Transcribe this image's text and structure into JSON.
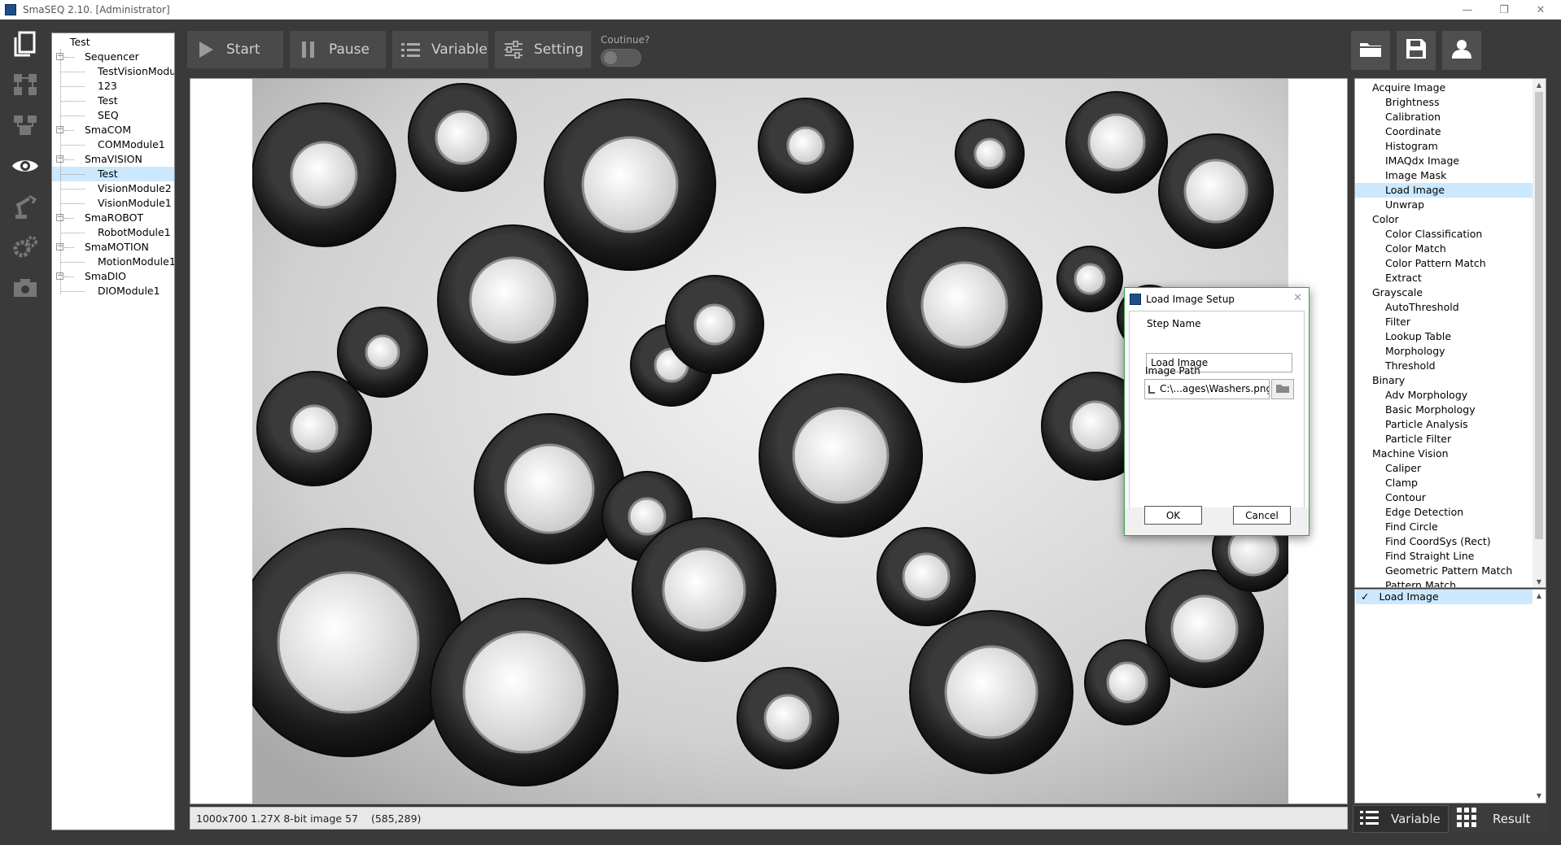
{
  "window": {
    "title": "SmaSEQ 2.10. [Administrator]",
    "minimize": "—",
    "maximize": "❐",
    "close": "✕"
  },
  "sidebar_icons": [
    "document-icon",
    "flow-icon",
    "module-icon",
    "eye-icon",
    "robot-arm-icon",
    "gears-icon",
    "camera-icon"
  ],
  "tree": [
    {
      "label": "Test",
      "level": 0
    },
    {
      "label": "Sequencer",
      "level": 1,
      "expander": "−"
    },
    {
      "label": "TestVisionModu",
      "level": 2
    },
    {
      "label": "123",
      "level": 2
    },
    {
      "label": "Test",
      "level": 2
    },
    {
      "label": "SEQ",
      "level": 2
    },
    {
      "label": "SmaCOM",
      "level": 1,
      "expander": "−"
    },
    {
      "label": "COMModule1",
      "level": 2
    },
    {
      "label": "SmaVISION",
      "level": 1,
      "expander": "−"
    },
    {
      "label": "Test",
      "level": 2,
      "selected": true
    },
    {
      "label": "VisionModule2",
      "level": 2
    },
    {
      "label": "VisionModule1",
      "level": 2
    },
    {
      "label": "SmaROBOT",
      "level": 1,
      "expander": "−"
    },
    {
      "label": "RobotModule1",
      "level": 2
    },
    {
      "label": "SmaMOTION",
      "level": 1,
      "expander": "−"
    },
    {
      "label": "MotionModule1",
      "level": 2
    },
    {
      "label": "SmaDIO",
      "level": 1,
      "expander": "−"
    },
    {
      "label": "DIOModule1",
      "level": 2
    }
  ],
  "toolbar": {
    "start": "Start",
    "pause": "Pause",
    "variable": "Variable",
    "setting": "Setting",
    "continue_label": "Coutinue?",
    "continue_on": false
  },
  "status": {
    "info": "1000x700 1.27X 8-bit image 57",
    "coord": "(585,289)"
  },
  "dialog": {
    "title": "Load Image Setup",
    "close": "✕",
    "step_name_label": "Step Name",
    "step_name_value": "Load Image",
    "image_path_label": "Image Path",
    "image_path_value": "C:\\...ages\\Washers.png",
    "ok": "OK",
    "cancel": "Cancel"
  },
  "steps": [
    {
      "label": "Acquire Image",
      "cat": true
    },
    {
      "label": "Brightness"
    },
    {
      "label": "Calibration"
    },
    {
      "label": "Coordinate"
    },
    {
      "label": "Histogram"
    },
    {
      "label": "IMAQdx Image"
    },
    {
      "label": "Image Mask"
    },
    {
      "label": "Load Image",
      "selected": true
    },
    {
      "label": "Unwrap"
    },
    {
      "label": "Color",
      "cat": true
    },
    {
      "label": "Color Classification"
    },
    {
      "label": "Color Match"
    },
    {
      "label": "Color Pattern Match"
    },
    {
      "label": "Extract"
    },
    {
      "label": "Grayscale",
      "cat": true
    },
    {
      "label": "AutoThreshold"
    },
    {
      "label": "Filter"
    },
    {
      "label": "Lookup Table"
    },
    {
      "label": "Morphology"
    },
    {
      "label": "Threshold"
    },
    {
      "label": "Binary",
      "cat": true
    },
    {
      "label": "Adv Morphology"
    },
    {
      "label": "Basic Morphology"
    },
    {
      "label": "Particle Analysis"
    },
    {
      "label": "Particle Filter"
    },
    {
      "label": "Machine Vision",
      "cat": true
    },
    {
      "label": "Caliper"
    },
    {
      "label": "Clamp"
    },
    {
      "label": "Contour"
    },
    {
      "label": "Edge Detection"
    },
    {
      "label": "Find Circle"
    },
    {
      "label": "Find CoordSys (Rect)"
    },
    {
      "label": "Find Straight Line"
    },
    {
      "label": "Geometric Pattern Match"
    },
    {
      "label": "Pattern Match"
    }
  ],
  "sequence": {
    "check": "✓",
    "item": "Load Image"
  },
  "bottom_tabs": {
    "variable": "Variable",
    "result": "Result"
  }
}
